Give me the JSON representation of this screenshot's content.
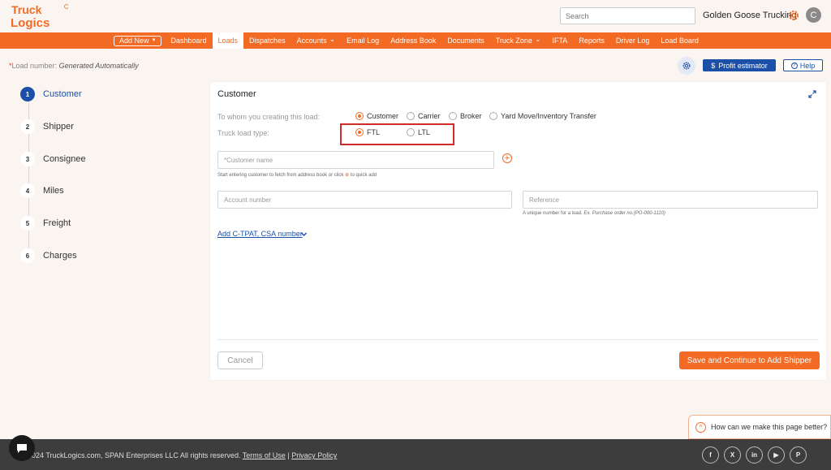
{
  "header": {
    "logo_top": "Truck",
    "logo_bottom": "Logics",
    "search_placeholder": "Search",
    "company_name": "Golden Goose Trucking",
    "avatar_initial": "C"
  },
  "nav": {
    "add_new": "Add New",
    "items": [
      {
        "label": "Dashboard",
        "dropdown": false
      },
      {
        "label": "Loads",
        "dropdown": false,
        "active": true
      },
      {
        "label": "Dispatches",
        "dropdown": false
      },
      {
        "label": "Accounts",
        "dropdown": true
      },
      {
        "label": "Email Log",
        "dropdown": false
      },
      {
        "label": "Address Book",
        "dropdown": false
      },
      {
        "label": "Documents",
        "dropdown": false
      },
      {
        "label": "Truck Zone",
        "dropdown": true
      },
      {
        "label": "IFTA",
        "dropdown": false
      },
      {
        "label": "Reports",
        "dropdown": false
      },
      {
        "label": "Driver Log",
        "dropdown": false
      },
      {
        "label": "Load Board",
        "dropdown": false
      }
    ]
  },
  "subheader": {
    "load_number_label": "Load number:",
    "load_number_value": "Generated Automatically",
    "profit_estimator": "Profit estimator",
    "help": "Help"
  },
  "steps": [
    {
      "num": "1",
      "label": "Customer",
      "active": true
    },
    {
      "num": "2",
      "label": "Shipper"
    },
    {
      "num": "3",
      "label": "Consignee"
    },
    {
      "num": "4",
      "label": "Miles"
    },
    {
      "num": "5",
      "label": "Freight"
    },
    {
      "num": "6",
      "label": "Charges"
    }
  ],
  "card": {
    "title": "Customer",
    "creating_for_label": "To whom you creating this load:",
    "creating_for_options": [
      "Customer",
      "Carrier",
      "Broker",
      "Yard Move/Inventory Transfer"
    ],
    "creating_for_selected": "Customer",
    "load_type_label": "Truck load type:",
    "load_type_options": [
      "FTL",
      "LTL"
    ],
    "load_type_selected": "FTL",
    "customer_name_placeholder": "*Customer name",
    "customer_hint_before": "Start entering customer to fetch from address book or click",
    "customer_hint_after": "to quick add",
    "account_placeholder": "Account number",
    "reference_placeholder": "Reference",
    "reference_hint_before": "A unique number for a load.",
    "reference_hint_italic": "Ex. Purchase order no.(PO-000-1110)",
    "ctpat_link": "Add C-TPAT, CSA number",
    "cancel": "Cancel",
    "save": "Save and Continue to Add Shipper"
  },
  "feedback": "How can we make this page better?",
  "footer": {
    "copyright": "2024 TruckLogics.com, SPAN Enterprises LLC All rights reserved.",
    "terms": "Terms of Use",
    "separator": "|",
    "privacy": "Privacy Policy",
    "socials": [
      "facebook-icon",
      "x-icon",
      "linkedin-icon",
      "youtube-icon",
      "pinterest-icon"
    ]
  },
  "colors": {
    "brand_orange": "#f26a24",
    "brand_blue": "#1b4fa8",
    "highlight_red": "#d12a2a"
  }
}
